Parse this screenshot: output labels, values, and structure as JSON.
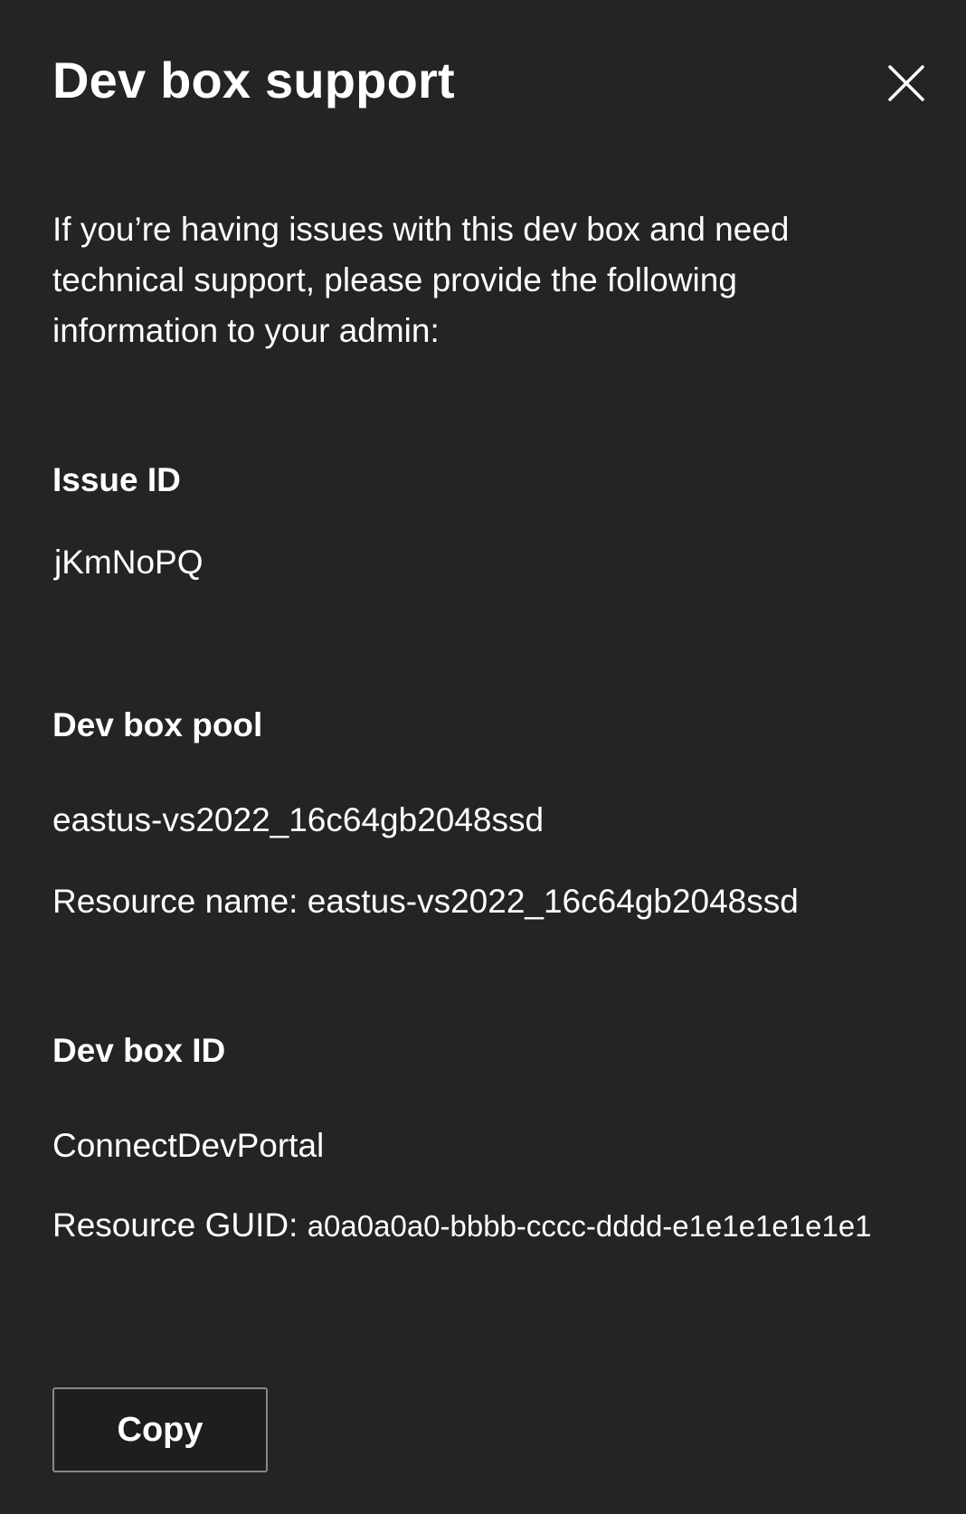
{
  "dialog": {
    "title": "Dev box support",
    "close_icon": "close-icon",
    "description": "If you’re having issues with this dev box and need technical support, please provide the following information to your admin:"
  },
  "issue": {
    "label": "Issue ID",
    "value": "jKmNoPQ"
  },
  "pool": {
    "label": "Dev box pool",
    "value": "eastus-vs2022_16c64gb2048ssd",
    "resource_name_label": "Resource name:",
    "resource_name_value": "eastus-vs2022_16c64gb2048ssd"
  },
  "devbox": {
    "label": "Dev box ID",
    "value": "ConnectDevPortal",
    "guid_label": "Resource GUID:",
    "guid_value": "a0a0a0a0-bbbb-cccc-dddd-e1e1e1e1e1e1"
  },
  "actions": {
    "copy_label": "Copy"
  },
  "colors": {
    "background": "#252423",
    "text": "#ffffff",
    "button_border": "#8a8886"
  }
}
